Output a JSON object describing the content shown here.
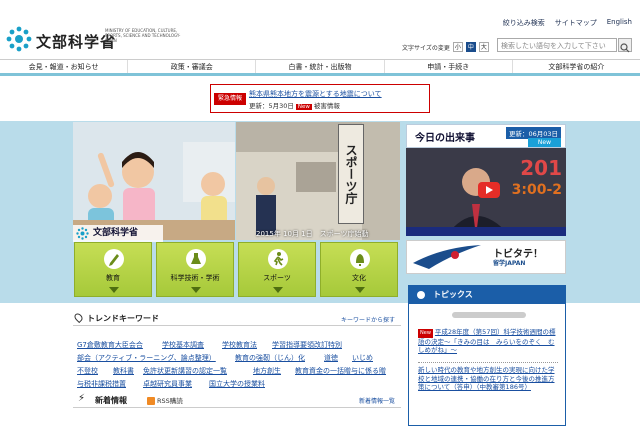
{
  "header": {
    "logo_text": "文部科学省",
    "logo_en": "MINISTRY OF EDUCATION, CULTURE, SPORTS, SCIENCE AND TECHNOLOGY-JAPAN",
    "links": [
      "絞り込み検索",
      "サイトマップ",
      "English"
    ],
    "font_size_label": "文字サイズの変更",
    "font_sizes": [
      "小",
      "中",
      "大"
    ],
    "font_size_selected": "中",
    "search_placeholder": "検索したい語句を入力して下さい"
  },
  "nav": [
    "会見・報道・お知らせ",
    "政策・審議会",
    "白書・統計・出版物",
    "申請・手続き",
    "文部科学省の紹介"
  ],
  "emergency": {
    "label": "緊急情報",
    "link": "熊本県熊本地方を震源とする地震について",
    "update_prefix": "更新：5月30日",
    "new": "New",
    "update_suffix": "被害情報"
  },
  "hero": {
    "caption": "2015年 10月 1日　スポーツ庁始動",
    "sign_text": "スポーツ庁",
    "badge_text": "文部科学省"
  },
  "tiles": [
    "教育",
    "科学技術・学術",
    "スポーツ",
    "文化"
  ],
  "today": {
    "title": "今日の出来事",
    "date": "更新：06月03日",
    "new": "New",
    "video_num": "201",
    "video_num2": "3:00-2"
  },
  "tobitate": {
    "title": "トビタテ！",
    "subtitle": "留学JAPAN"
  },
  "trend": {
    "title": "トレンドキーワード",
    "more": "キーワードから探す",
    "keywords": [
      "G7倉敷教育大臣会合",
      "学校基本調査",
      "学校教育法",
      "学習指導要領改訂特別",
      "部会（アクティブ・ラーニング、論点整理）",
      "教育の強靭（じん）化",
      "道徳",
      "いじめ",
      "不登校",
      "教科書",
      "免許状更新講習の認定一覧",
      "地方創生",
      "教育資金の一括贈与に係る贈",
      "与税非課税措置",
      "卓越研究員事業",
      "国立大学の授業料"
    ]
  },
  "news": {
    "title": "新着情報",
    "rss": "RSS購読",
    "more": "新着情報一覧"
  },
  "topics": {
    "title": "トピックス",
    "items": [
      {
        "new": "New",
        "text": "平成28年度（第57回）科学技術週間の標語の決定～「きみの目は　みらいをのぞく　むしめがね」～"
      },
      {
        "new": "",
        "text": "新しい時代の教育や地方創生の実現に向けた学校と地域の連携・協働の在り方と今後の推進方策について（答申）（中教審第186号）"
      }
    ]
  },
  "colors": {
    "accent": "#1b5ea8",
    "emergency": "#cc0000",
    "tile_green": "#b3d145",
    "hero_bg": "#b9dcea"
  }
}
